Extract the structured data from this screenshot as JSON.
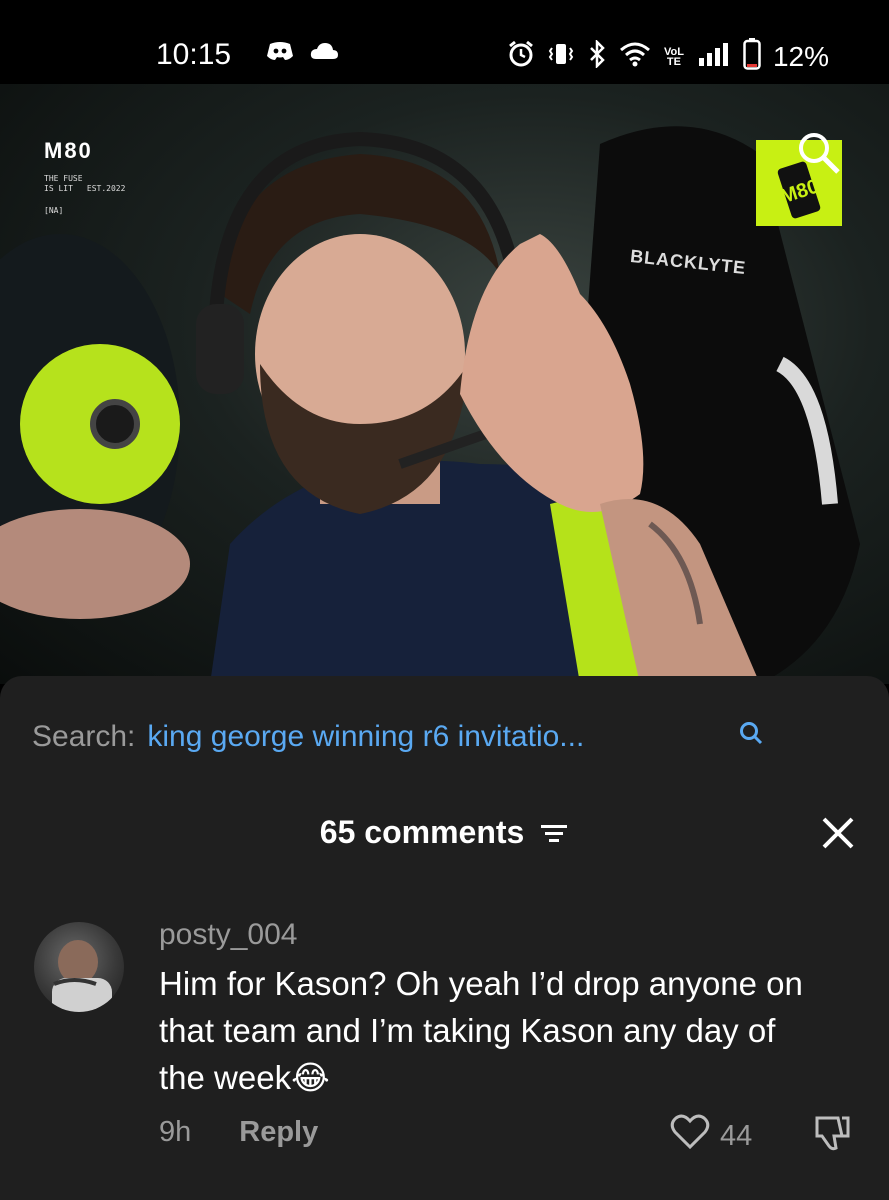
{
  "status_bar": {
    "time": "10:15",
    "battery_percent": "12%",
    "network_label": "VoLTE",
    "icons": [
      "discord-icon",
      "cloud-icon",
      "alarm-icon",
      "vibrate-icon",
      "bluetooth-icon",
      "wifi-icon",
      "signal-icon",
      "battery-icon"
    ]
  },
  "video": {
    "overlay_brand": "M80",
    "overlay_line1": "THE FUSE",
    "overlay_line2": "IS LIT",
    "overlay_est": "EST.2022",
    "overlay_region": "[NA]",
    "badge_text": "M80",
    "chair_brand": "BLACKLYTE"
  },
  "search": {
    "prefix": "Search:",
    "query": "king george winning r6 invitatio..."
  },
  "comments": {
    "count_label": "65 comments",
    "items": [
      {
        "username": "posty_004",
        "text": "Him for Kason? Oh yeah I’d drop anyone on that team and I’m taking Kason any day of the week😂",
        "time": "9h",
        "reply_label": "Reply",
        "likes": "44"
      }
    ]
  },
  "colors": {
    "accent_blue": "#5aa9f2",
    "sheet_bg": "#1f1f1f",
    "m80_green": "#c8f013",
    "muted_text": "#9a9a9a"
  }
}
